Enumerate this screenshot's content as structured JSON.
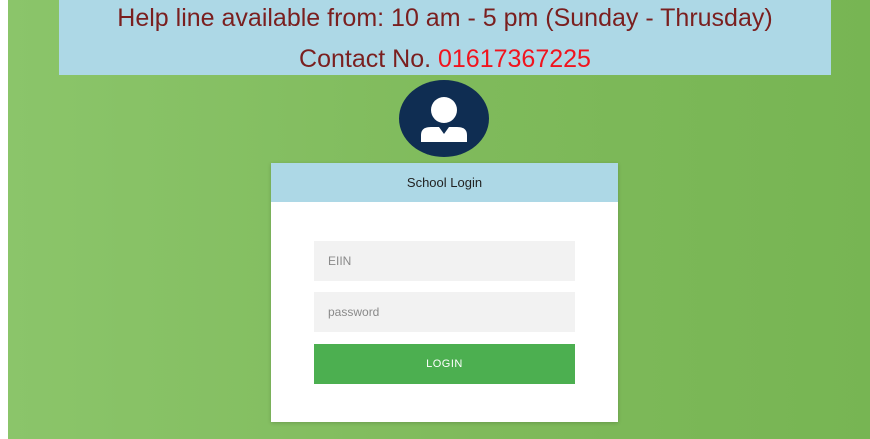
{
  "helpline": {
    "text": "Help line available from: 10 am - 5 pm (Sunday - Thrusday)",
    "contact_label": "Contact No.",
    "contact_number": "01617367225"
  },
  "avatar": {
    "icon": "user-icon"
  },
  "login_card": {
    "title": "School Login",
    "eiin_placeholder": "EIIN",
    "password_placeholder": "password",
    "submit_label": "LOGIN"
  },
  "colors": {
    "background": "#7fba5b",
    "banner": "#add8e6",
    "banner_text": "#7a1f1f",
    "phone_text": "#f0141e",
    "avatar_bg": "#0f2d52",
    "login_button": "#4caf50"
  }
}
